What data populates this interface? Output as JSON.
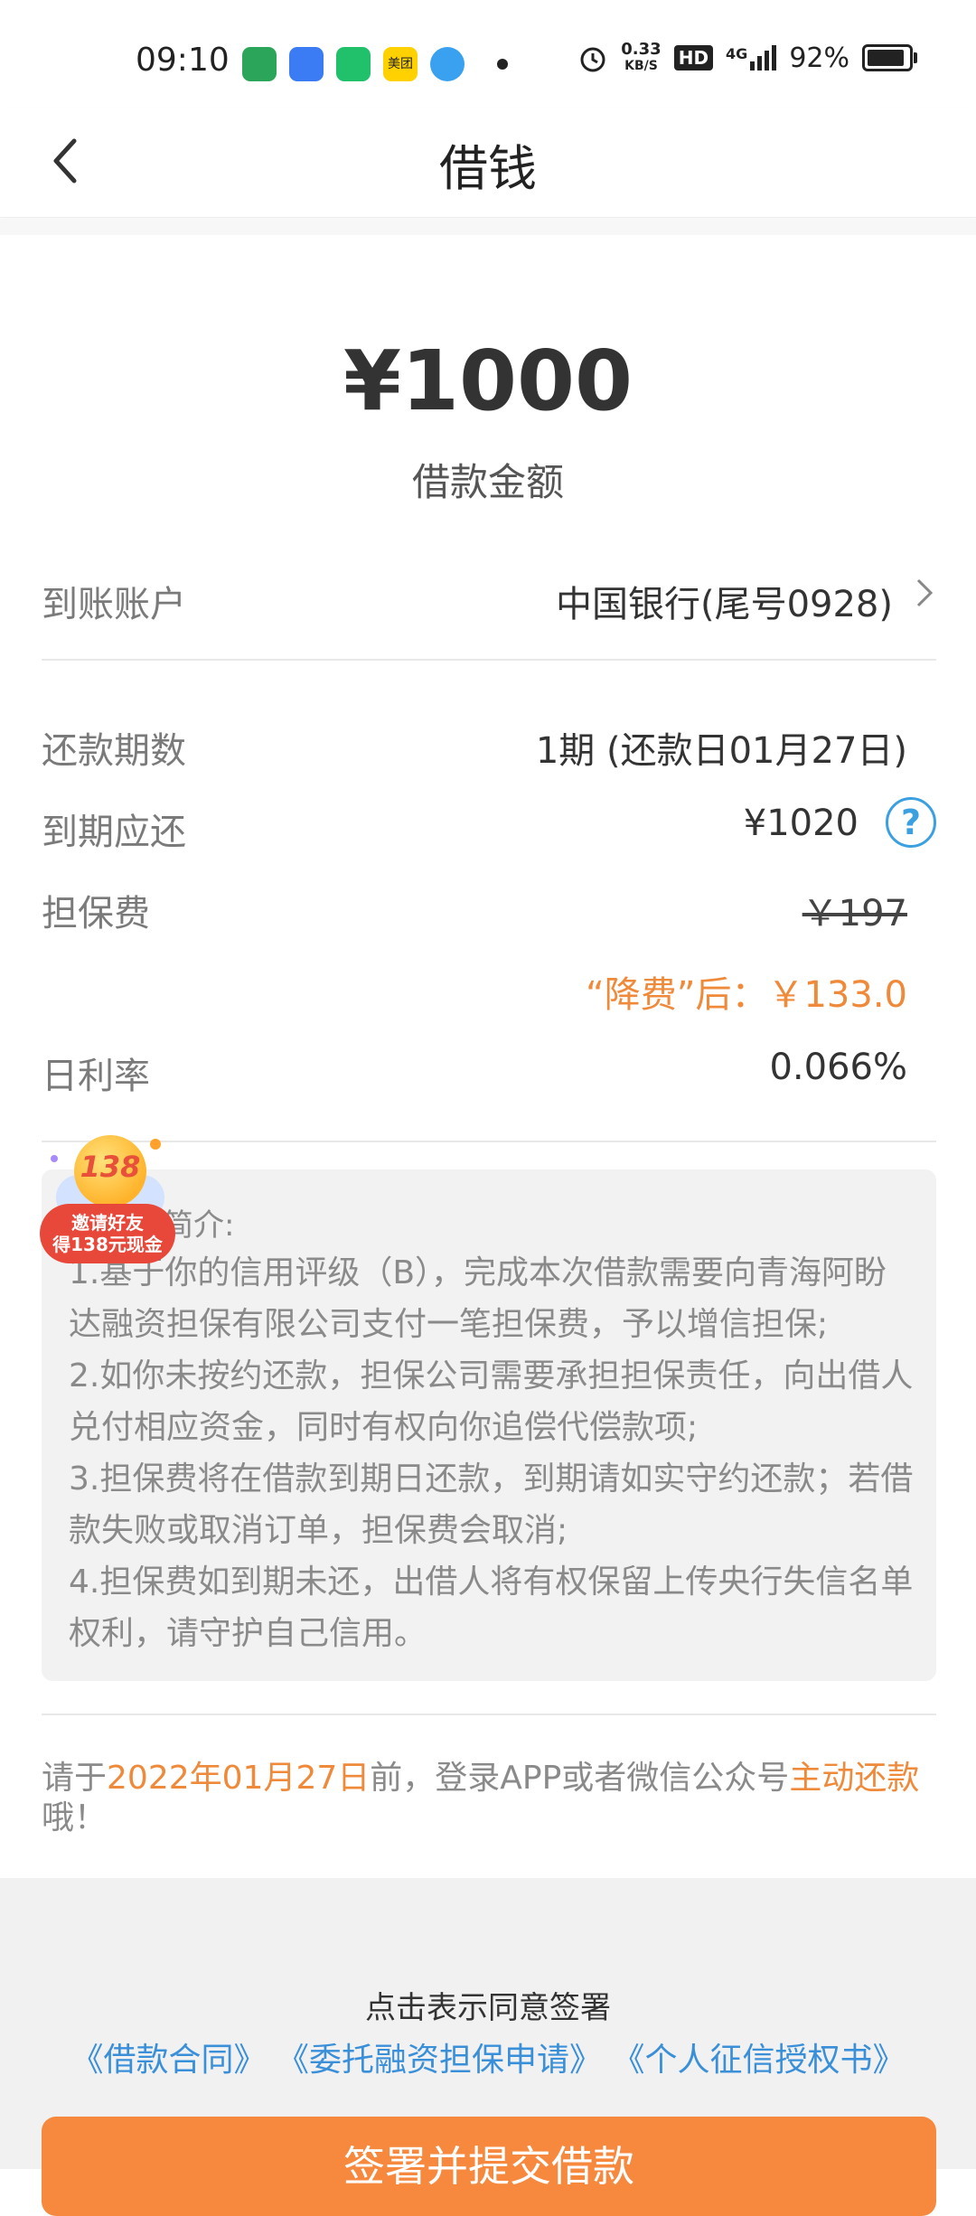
{
  "status_bar": {
    "time": "09:10",
    "net_speed_value": "0.33",
    "net_speed_unit": "KB/S",
    "hd": "HD",
    "signal": "4G",
    "battery": "92%",
    "battery_level": 0.92,
    "apps": [
      {
        "name": "video-app-icon",
        "color": "#2aa55a"
      },
      {
        "name": "blue-app-icon",
        "color": "#3b7cf5"
      },
      {
        "name": "green-app-icon",
        "color": "#21c06b"
      },
      {
        "name": "meituan-icon",
        "color": "#ffd100",
        "label": "美团"
      },
      {
        "name": "browser-icon",
        "color": "#3aa0f0"
      }
    ]
  },
  "nav": {
    "title": "借钱"
  },
  "loan": {
    "amount": "¥1000",
    "amount_label": "借款金额",
    "account_label": "到账账户",
    "account_value": "中国银行(尾号0928)",
    "term_label": "还款期数",
    "term_value": "1期 (还款日01月27日)",
    "due_label": "到期应还",
    "due_value": "¥1020",
    "help": "?",
    "fee_label": "担保费",
    "fee_original": "￥197",
    "fee_discount": "“降费”后：￥133.0",
    "rate_label": "日利率",
    "rate_value": "0.066%"
  },
  "badge": {
    "number": "138",
    "line1": "邀请好友",
    "line2": "得138元现金"
  },
  "info": {
    "title": "简介:",
    "lines": [
      "1.基于你的信用评级（B），完成本次借款需要向青海阿盼",
      "达融资担保有限公司支付一笔担保费，予以增信担保;",
      "2.如你未按约还款，担保公司需要承担担保责任，向出借人",
      "兑付相应资金，同时有权向你追偿代偿款项;",
      "3.担保费将在借款到期日还款，到期请如实守约还款；若借",
      "款失败或取消订单，担保费会取消;",
      "4.担保费如到期未还，出借人将有权保留上传央行失信名单",
      "权利，请守护自己信用。"
    ]
  },
  "notice": {
    "prefix": "请于",
    "date": "2022年01月27日",
    "middle": "前，登录APP或者微信公众号",
    "action": "主动还款",
    "suffix": "哦！"
  },
  "footer": {
    "agree_text": "点击表示同意签署",
    "docs": [
      "《借款合同》",
      "《委托融资担保申请》",
      "《个人征信授权书》"
    ],
    "submit_label": "签署并提交借款"
  }
}
